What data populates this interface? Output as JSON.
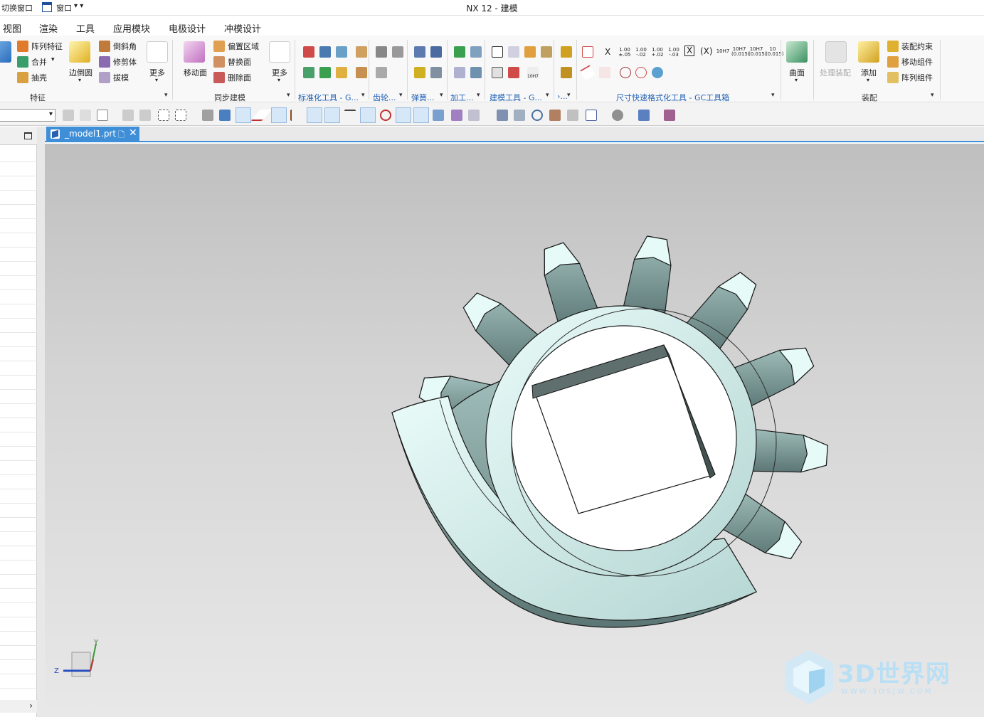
{
  "quick_access": {
    "switch_window": "切换窗口",
    "window": "窗口",
    "window_dropdown": "▾ ▾"
  },
  "app": {
    "title": "NX 12 - 建模"
  },
  "menu": [
    "视图",
    "渲染",
    "工具",
    "应用模块",
    "电极设计",
    "冲模设计"
  ],
  "ribbon": {
    "feature": {
      "items": [
        "阵列特征",
        "合并",
        "抽壳",
        "边倒圆",
        "倒斜角",
        "修剪体",
        "拔模",
        "更多"
      ],
      "label": "特征"
    },
    "sync": {
      "items": [
        "移动面",
        "偏置区域",
        "替换面",
        "删除面",
        "更多"
      ],
      "label": "同步建模"
    },
    "groups": [
      "标准化工具 - G...",
      "齿轮...",
      "弹簧...",
      "加工...",
      "建模工具 - G...",
      "›..."
    ],
    "dim_group": {
      "label": "尺寸快速格式化工具 - GC工具箱",
      "x": "X",
      "tol": [
        "1.00\n±.05",
        "1.00\n-.02",
        "1.00\n+.02",
        "1.00\n-.03"
      ],
      "boxx": "X",
      "parx": "(X)",
      "fits": [
        "10H7",
        "10H7\n(0.015)",
        "10H7\n(0.015)",
        "10\n(0.015)"
      ],
      "tenh7": "10H7"
    },
    "surface": {
      "label": "曲面"
    },
    "assembly": {
      "items": [
        "处理装配",
        "添加",
        "装配约束",
        "移动组件",
        "阵列组件"
      ],
      "label": "装配"
    }
  },
  "document": {
    "tab_label": "_model1.prt",
    "save_glyph": "🗋",
    "close_glyph": "✕"
  },
  "triad": {
    "y": "Y",
    "z": "Z"
  },
  "watermark": {
    "text": "3D世界网",
    "sub": "WWW.3DSJW.COM"
  },
  "colors": {
    "accent": "#3f8fd8",
    "part_face": "#cfe8e6",
    "part_shadow": "#6f8a88"
  }
}
